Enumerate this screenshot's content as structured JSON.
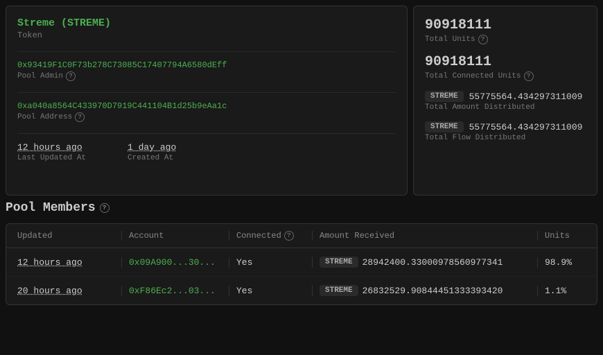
{
  "leftPanel": {
    "tokenName": "Streme (STREME)",
    "tokenLabel": "Token",
    "poolAdmin": {
      "value": "0x93419F1C0F73b278C73085C17407794A6580dEff",
      "label": "Pool Admin"
    },
    "poolAddress": {
      "value": "0xa040a8564C433970D7919C441104B1d25b9eAa1c",
      "label": "Pool Address"
    },
    "lastUpdated": {
      "value": "12 hours ago",
      "label": "Last Updated At"
    },
    "createdAt": {
      "value": "1 day ago",
      "label": "Created At"
    }
  },
  "rightPanel": {
    "totalUnits": {
      "value": "90918111",
      "label": "Total Units"
    },
    "totalConnectedUnits": {
      "value": "90918111",
      "label": "Total Connected Units"
    },
    "totalAmountDistributed": {
      "badge": "STREME",
      "value": "55775564.434297311009",
      "label": "Total Amount Distributed"
    },
    "totalFlowDistributed": {
      "badge": "STREME",
      "value": "55775564.434297311009",
      "label": "Total Flow Distributed"
    }
  },
  "poolMembers": {
    "title": "Pool Members",
    "helpIcon": "?",
    "columns": {
      "updated": "Updated",
      "account": "Account",
      "connected": "Connected",
      "amountReceived": "Amount Received",
      "units": "Units"
    },
    "rows": [
      {
        "updated": "12 hours ago",
        "account": "0x09A900...30...",
        "connected": "Yes",
        "badge": "STREME",
        "amount": "28942400.33000978560977341",
        "units": "98.9%"
      },
      {
        "updated": "20 hours ago",
        "account": "0xF86Ec2...03...",
        "connected": "Yes",
        "badge": "STREME",
        "amount": "26832529.90844451333393420",
        "units": "1.1%"
      }
    ]
  }
}
